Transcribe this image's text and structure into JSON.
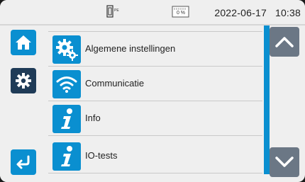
{
  "status": {
    "battery_text": "0 %",
    "date": "2022-06-17",
    "time": "10:38"
  },
  "sidebar": {
    "home_icon": "home-icon",
    "settings_icon": "gear-icon",
    "back_icon": "return-arrow-icon"
  },
  "menu": {
    "items": [
      {
        "label": "Algemene instellingen",
        "icon": "gears-icon"
      },
      {
        "label": "Communicatie",
        "icon": "wifi-icon"
      },
      {
        "label": "Info",
        "icon": "info-icon"
      },
      {
        "label": "IO-tests",
        "icon": "info-icon"
      }
    ]
  },
  "scroll": {
    "up_icon": "chevron-up-icon",
    "down_icon": "chevron-down-icon"
  },
  "colors": {
    "accent": "#0a8fd0",
    "active": "#1f3b57",
    "scroll_button": "#6b7785",
    "background": "#efefef"
  }
}
